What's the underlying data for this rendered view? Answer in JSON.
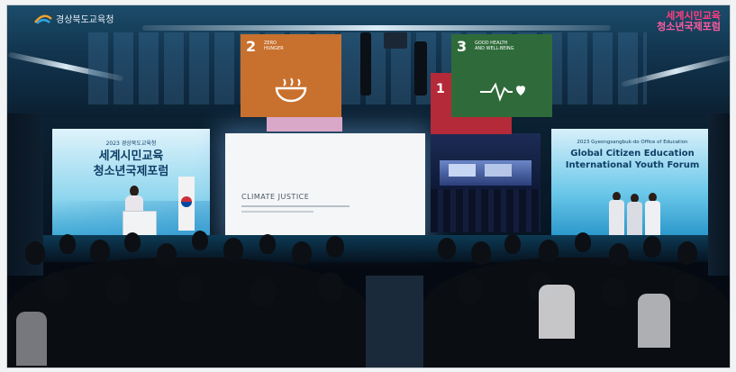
{
  "overlay": {
    "logo_text": "경상북도교육청",
    "watermark_line1": "세계시민교육",
    "watermark_line2": "청소년국제포럼"
  },
  "left_screen": {
    "small": "2023 경상북도교육청",
    "line1": "세계시민교육",
    "line2": "청소년국제포럼"
  },
  "main_screen": {
    "title": "CLIMATE JUSTICE"
  },
  "right_screen": {
    "small": "2023 Gyeongsangbuk-do Office of Education",
    "line1": "Global Citizen Education",
    "line2": "International Youth Forum"
  },
  "banners": {
    "sdg2_number": "2",
    "sdg2_label": "ZERO\nHUNGER",
    "sdg3_number": "3",
    "sdg3_label": "GOOD HEALTH\nAND WELL-BEING",
    "sdg1_number": "1"
  },
  "colors": {
    "sdg2": "#d3a029",
    "sdg3": "#4c9f38",
    "sdg1": "#e5243b",
    "stage_blue": "#3aa9d6",
    "watermark": "#ff4f8a"
  }
}
